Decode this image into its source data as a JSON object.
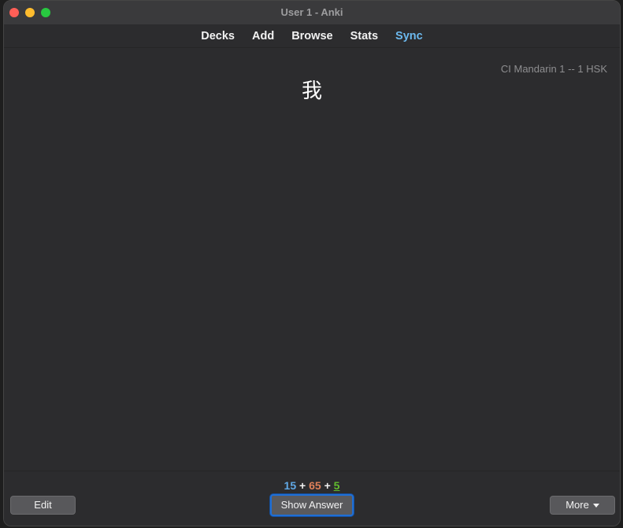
{
  "window": {
    "title": "User 1 - Anki"
  },
  "toolbar": {
    "decks": "Decks",
    "add": "Add",
    "browse": "Browse",
    "stats": "Stats",
    "sync": "Sync",
    "sync_color": "#6cb9ee"
  },
  "card": {
    "deck_name": "CI Mandarin 1 -- 1 HSK",
    "question": "我"
  },
  "counts": {
    "new": "15",
    "learning": "65",
    "review": "5",
    "separator": "+",
    "new_color": "#61a9e6",
    "learning_color": "#e0815a",
    "review_color": "#62bd2e"
  },
  "buttons": {
    "edit": "Edit",
    "show_answer": "Show Answer",
    "more": "More"
  }
}
